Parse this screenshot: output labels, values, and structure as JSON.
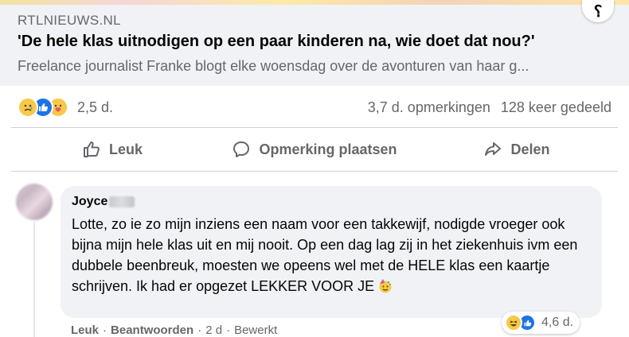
{
  "link_preview": {
    "domain": "RTLNIEUWS.NL",
    "headline": "'De hele klas uitnodigen op een paar kinderen na, wie doet dat nou?'",
    "description": "Freelance journalist Franke blogt elke woensdag over de avonturen van haar g..."
  },
  "stats": {
    "reaction_icons": [
      "sad-emoji-icon",
      "like-thumb-icon",
      "care-emoji-icon"
    ],
    "reaction_count": "2,5 d.",
    "comments": "3,7 d. opmerkingen",
    "shares": "128 keer gedeeld"
  },
  "actions": {
    "like": "Leuk",
    "comment": "Opmerking plaatsen",
    "share": "Delen"
  },
  "comment": {
    "author": "Joyce",
    "text": "Lotte, zo ie zo mijn inziens een naam voor een takkewijf, nodigde vroeger ook bijna mijn hele klas uit en mij nooit. Op een dag lag zij in het ziekenhuis ivm een dubbele beenbreuk, moesten we opeens wel met de HELE klas een kaartje schrijven. Ik had er opgezet LEKKER VOOR JE",
    "reaction_icons": [
      "haha-emoji-icon",
      "like-thumb-icon"
    ],
    "reaction_count": "4,6 d.",
    "footer": {
      "like": "Leuk",
      "reply": "Beantwoorden",
      "separator": "·",
      "age": "2 d",
      "edited": "Bewerkt"
    }
  },
  "colors": {
    "facebook_blue": "#1b74e4",
    "secondary_text": "#65676b",
    "bubble_bg": "#f0f2f5",
    "emoji_yellow": "#f7c94a"
  }
}
